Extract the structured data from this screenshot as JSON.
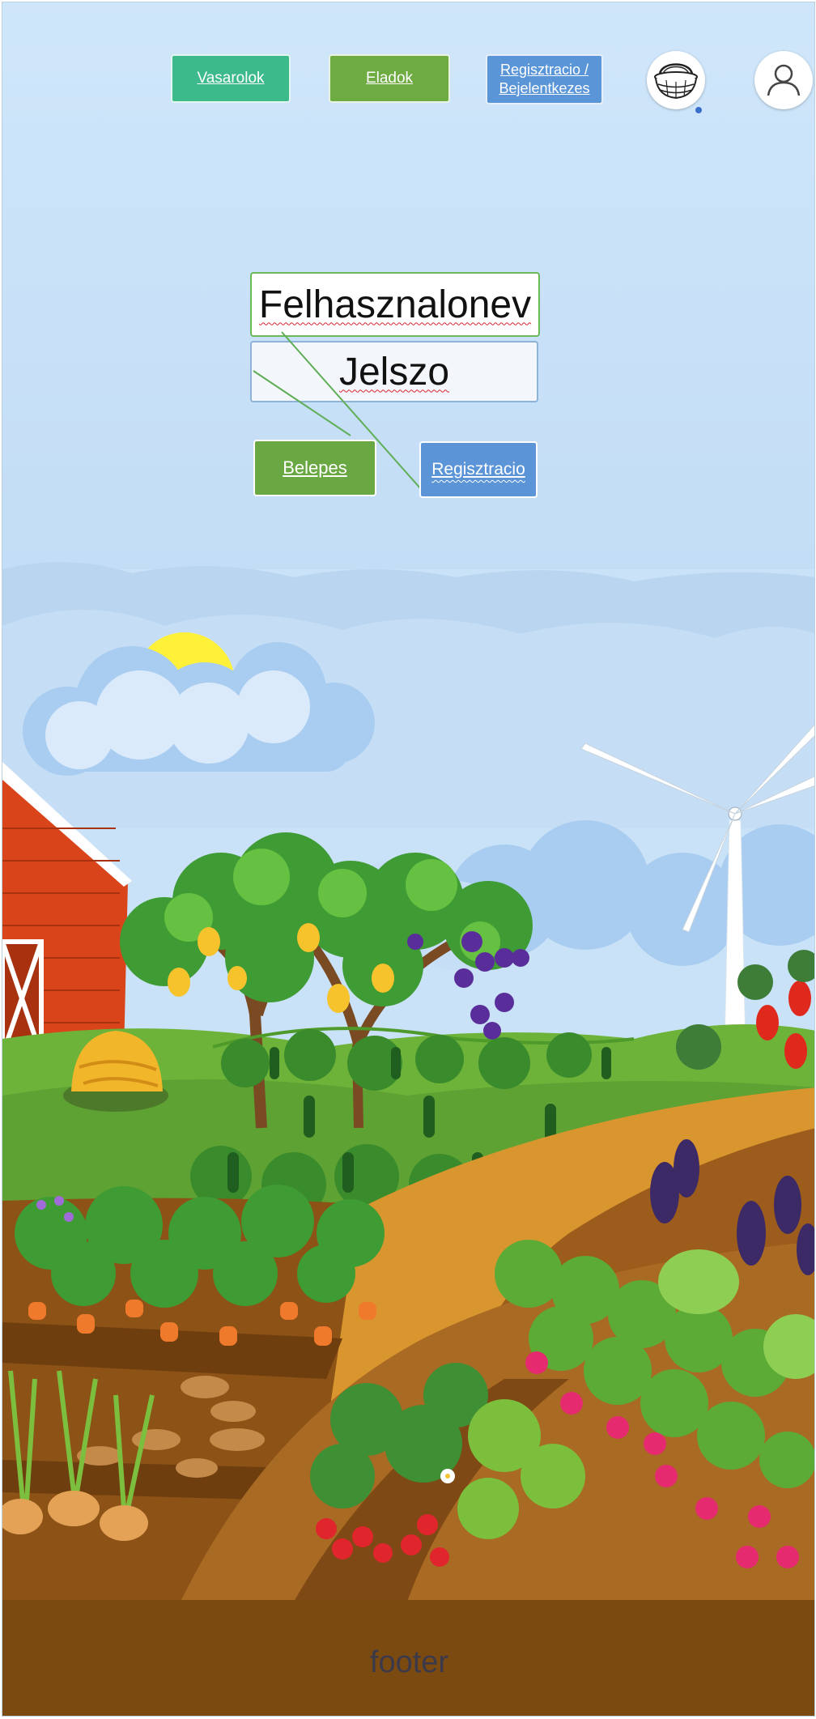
{
  "nav": {
    "buyers_label": "Vasarolok",
    "sellers_label": "Eladok",
    "register_login_line1": "Regisztracio /",
    "register_login_line2": "Bejelentkezes",
    "basket_icon": "basket-icon",
    "user_icon": "user-icon"
  },
  "login_form": {
    "username_value": "Felhasznalonev",
    "password_value": "Jelszo",
    "login_label": "Belepes",
    "register_label": "Regisztracio"
  },
  "footer": {
    "text": "footer"
  },
  "colors": {
    "buyers_button": "#3dba8c",
    "sellers_button": "#6eab40",
    "register_button": "#5a95d8",
    "footer_bg": "#7b4a11"
  },
  "illustration": "farm-garden-illustration"
}
